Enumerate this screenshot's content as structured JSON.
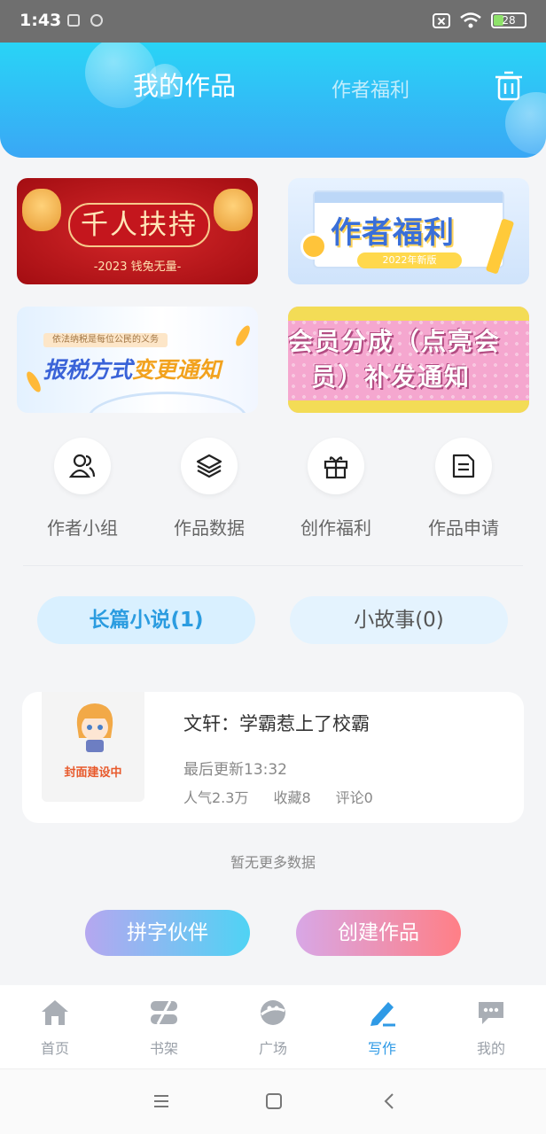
{
  "status_bar": {
    "time": "1:43",
    "battery": "28"
  },
  "header": {
    "tab_active": "我的作品",
    "tab_inactive": "作者福利"
  },
  "banners": {
    "b1_title": "千人扶持",
    "b1_sub": "-2023 钱兔无量-",
    "b2_title": "作者福利",
    "b2_pill": "2022年新版",
    "b3_tag": "依法纳税是每位公民的义务",
    "b3_title_a": "报税方式",
    "b3_title_b": "变更通知",
    "b4_line1": "会员分成（点亮会",
    "b4_line2": "员）补发通知"
  },
  "quick_links": [
    {
      "label": "作者小组",
      "icon": "people-icon"
    },
    {
      "label": "作品数据",
      "icon": "layers-icon"
    },
    {
      "label": "创作福利",
      "icon": "gift-icon"
    },
    {
      "label": "作品申请",
      "icon": "document-icon"
    }
  ],
  "segments": {
    "long": "长篇小说(1)",
    "short": "小故事(0)"
  },
  "work": {
    "cover_caption": "封面建设中",
    "title": "文轩：学霸惹上了校霸",
    "updated": "最后更新13:32",
    "popularity": "人气2.3万",
    "favorites": "收藏8",
    "comments": "评论0"
  },
  "no_more": "暂无更多数据",
  "actions": {
    "partner": "拼字伙伴",
    "create": "创建作品"
  },
  "nav": [
    {
      "label": "首页",
      "icon": "home-icon"
    },
    {
      "label": "书架",
      "icon": "bookshelf-icon"
    },
    {
      "label": "广场",
      "icon": "planet-icon"
    },
    {
      "label": "写作",
      "icon": "pen-icon",
      "active": true
    },
    {
      "label": "我的",
      "icon": "chat-icon"
    }
  ],
  "colors": {
    "accent": "#2f9ae6",
    "header_top": "#29d4f6",
    "header_bottom": "#3aa7f5"
  }
}
